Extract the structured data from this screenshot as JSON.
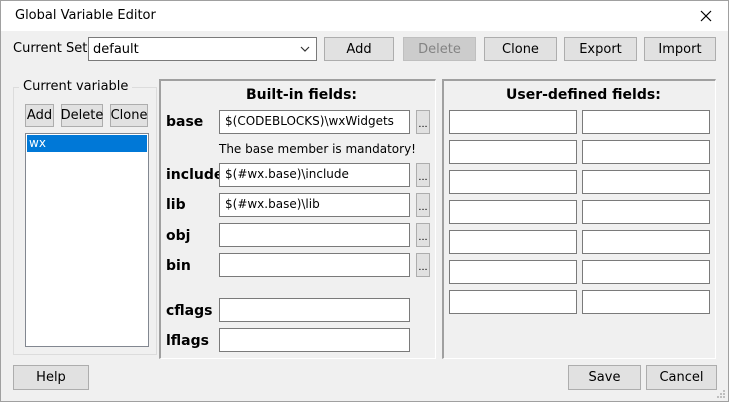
{
  "window": {
    "title": "Global Variable Editor"
  },
  "top": {
    "current_set_label": "Current Set:",
    "current_set_value": "default",
    "add": "Add",
    "delete": "Delete",
    "clone": "Clone",
    "export": "Export",
    "import": "Import"
  },
  "left": {
    "group_title": "Current variable",
    "add": "Add",
    "delete": "Delete",
    "clone": "Clone",
    "items": [
      "wx"
    ]
  },
  "builtin": {
    "title": "Built-in fields:",
    "base_label": "base",
    "base_value": "$(CODEBLOCKS)\\wxWidgets",
    "mandatory_note": "The base member is mandatory!",
    "include_label": "include",
    "include_value": "$(#wx.base)\\include",
    "lib_label": "lib",
    "lib_value": "$(#wx.base)\\lib",
    "obj_label": "obj",
    "obj_value": "",
    "bin_label": "bin",
    "bin_value": "",
    "cflags_label": "cflags",
    "cflags_value": "",
    "lflags_label": "lflags",
    "lflags_value": "",
    "browse": "..."
  },
  "user": {
    "title": "User-defined fields:"
  },
  "bottom": {
    "help": "Help",
    "save": "Save",
    "cancel": "Cancel"
  }
}
